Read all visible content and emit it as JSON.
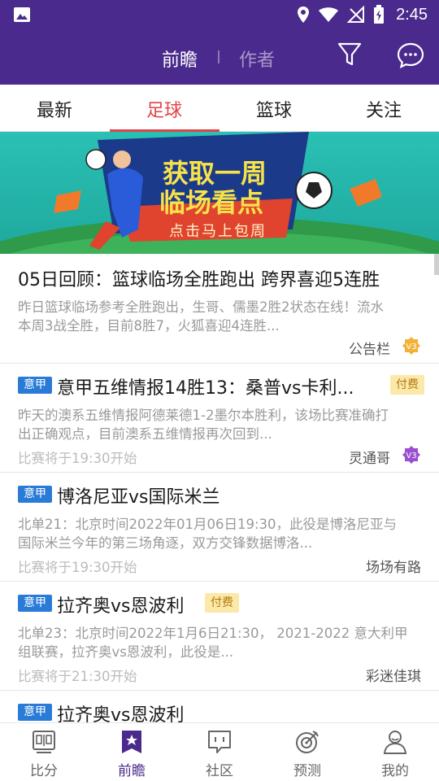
{
  "status_bar": {
    "time": "2:45"
  },
  "header": {
    "tab_active": "前瞻",
    "tab_inactive": "作者"
  },
  "categories": [
    "最新",
    "足球",
    "篮球",
    "关注"
  ],
  "banner": {
    "line1": "获取一周",
    "line2": "临场看点",
    "cta": "点击马上包周"
  },
  "articles": [
    {
      "title": "05日回顾：篮球临场全胜跑出 跨界喜迎5连胜",
      "body1": "昨日篮球临场参考全胜跑出，生哥、儒墨2胜2状态在线！流水",
      "body2": "本周3战全胜，目前8胜7，火狐喜迎4连胜...",
      "author": "公告栏",
      "badge": "V3",
      "badge_color": "#f2b23a"
    },
    {
      "tag": "意甲",
      "title": "意甲五维情报14胜13：桑普vs卡利...",
      "paid": "付费",
      "body1": "昨天的澳系五维情报阿德莱德1-2墨尔本胜利，该场比赛准确打",
      "body2": "出正确观点，目前澳系五维情报再次回到...",
      "meta": "比赛将于19:30开始",
      "author": "灵通哥",
      "badge": "V3",
      "badge_color": "#9b4fd0"
    },
    {
      "tag": "意甲",
      "title": "博洛尼亚vs国际米兰",
      "body1": "北单21：北京时间2022年01月06日19:30，此役是博洛尼亚与",
      "body2": "国际米兰今年的第三场角逐，双方交锋数据博洛...",
      "meta": "比赛将于19:30开始",
      "author": "场场有路"
    },
    {
      "tag": "意甲",
      "title": "拉齐奥vs恩波利",
      "paid": "付费",
      "body1": "北单23：北京时间2022年1月6日21:30， 2021-2022 意大利甲",
      "body2": "组联赛，拉齐奥vs恩波利，此役是...",
      "meta": "比赛将于21:30开始",
      "author": "彩迷佳琪"
    },
    {
      "tag": "意甲",
      "title": "拉齐奥vs恩波利"
    }
  ],
  "bottom_nav": [
    {
      "label": "比分",
      "icon": "scoreboard-icon"
    },
    {
      "label": "前瞻",
      "icon": "star-doc-icon"
    },
    {
      "label": "社区",
      "icon": "community-icon"
    },
    {
      "label": "预测",
      "icon": "target-icon"
    },
    {
      "label": "我的",
      "icon": "profile-icon"
    }
  ],
  "colors": {
    "brand": "#4a2a8c",
    "accent": "#e0434a",
    "tag": "#2a7bd8"
  }
}
